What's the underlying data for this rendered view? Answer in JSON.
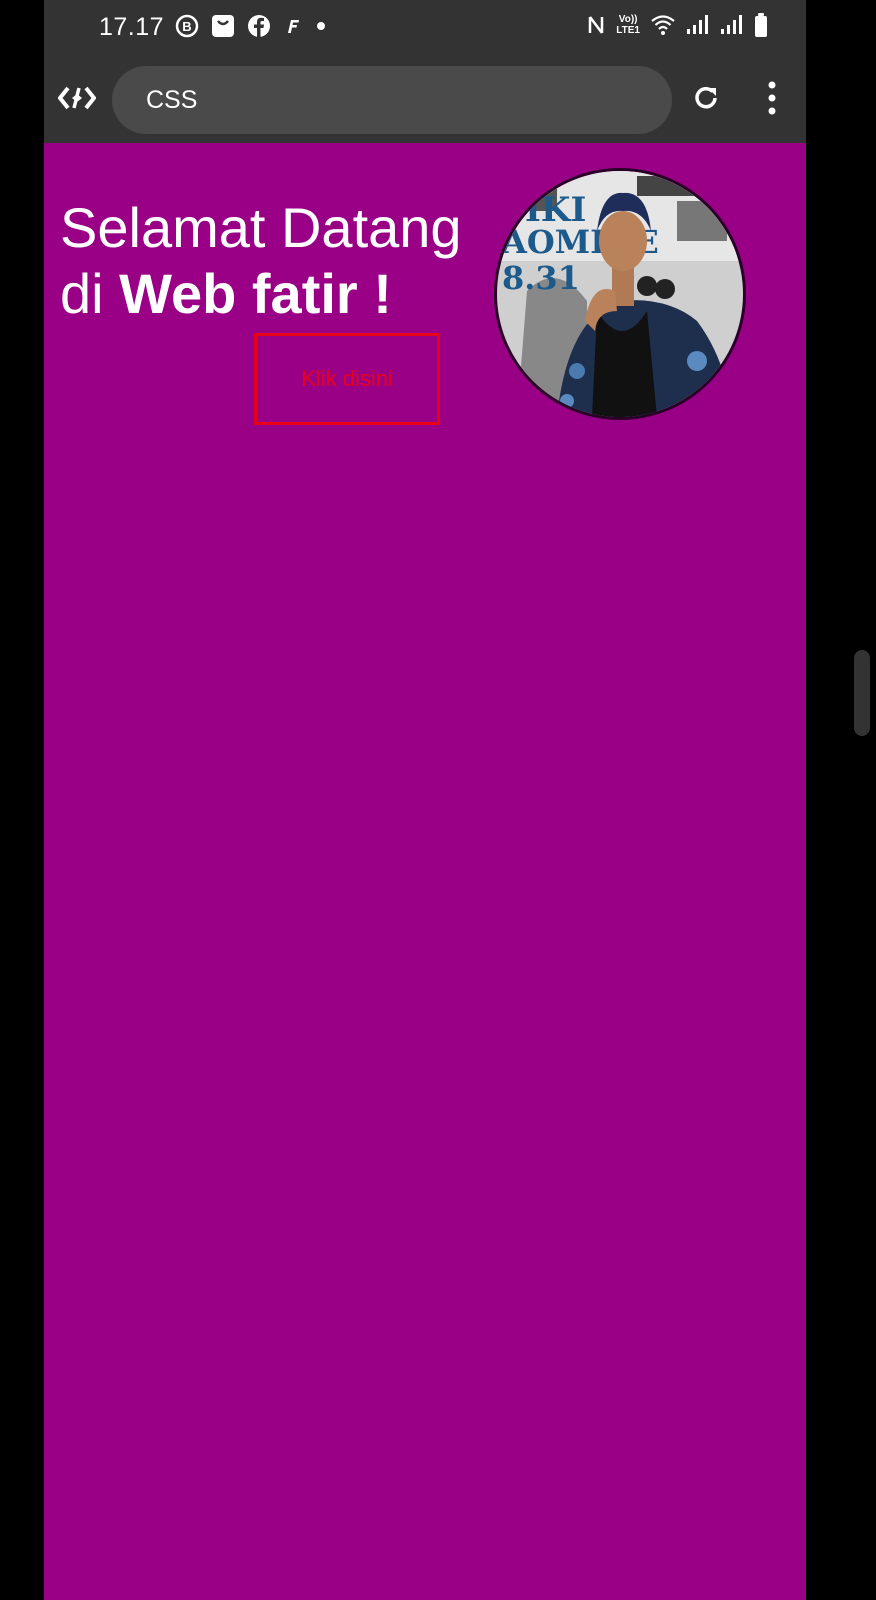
{
  "status_bar": {
    "time": "17.17",
    "left_icons": [
      "b-circle-icon",
      "shopping-bag-icon",
      "facebook-icon",
      "f-app-icon",
      "dot-icon"
    ],
    "right_icons": [
      "nfc-icon",
      "volte-icon",
      "wifi-icon",
      "signal-icon",
      "signal-icon",
      "battery-icon"
    ],
    "volte_top": "Vo))",
    "volte_bottom": "LTE1"
  },
  "browser": {
    "url": "CSS",
    "logo_icon": "code-editor-logo-icon",
    "reload_icon": "reload-icon",
    "menu_icon": "more-vertical-icon"
  },
  "page": {
    "heading_line1": "Selamat Datang",
    "heading_line2_prefix": "di ",
    "heading_line2_bold": "Web fatir !",
    "button_label": "Klik disini",
    "background_color": "#990085",
    "button_color": "#e8001b",
    "avatar": {
      "alt": "profile-photo",
      "text_lines": [
        "IKI",
        "AOMINE",
        "8.31"
      ]
    }
  }
}
